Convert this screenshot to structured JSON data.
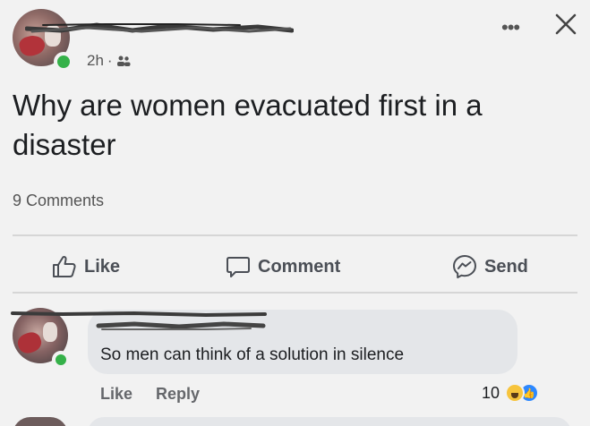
{
  "post": {
    "time_label": "2h",
    "separator": "·",
    "audience_icon": "friends-icon",
    "text": "Why are women evacuated first in a disaster",
    "comment_count": "9 Comments"
  },
  "actions": {
    "like_label": "Like",
    "comment_label": "Comment",
    "send_label": "Send"
  },
  "comment": {
    "text": "So men can think of a solution in silence",
    "like_label": "Like",
    "reply_label": "Reply",
    "reaction_count": "10",
    "reactions": [
      "haha",
      "like"
    ]
  },
  "colors": {
    "online": "#35b149",
    "bubble": "#e4e6e9",
    "like_blue": "#2d88ff",
    "haha_yellow": "#f7c43c"
  }
}
